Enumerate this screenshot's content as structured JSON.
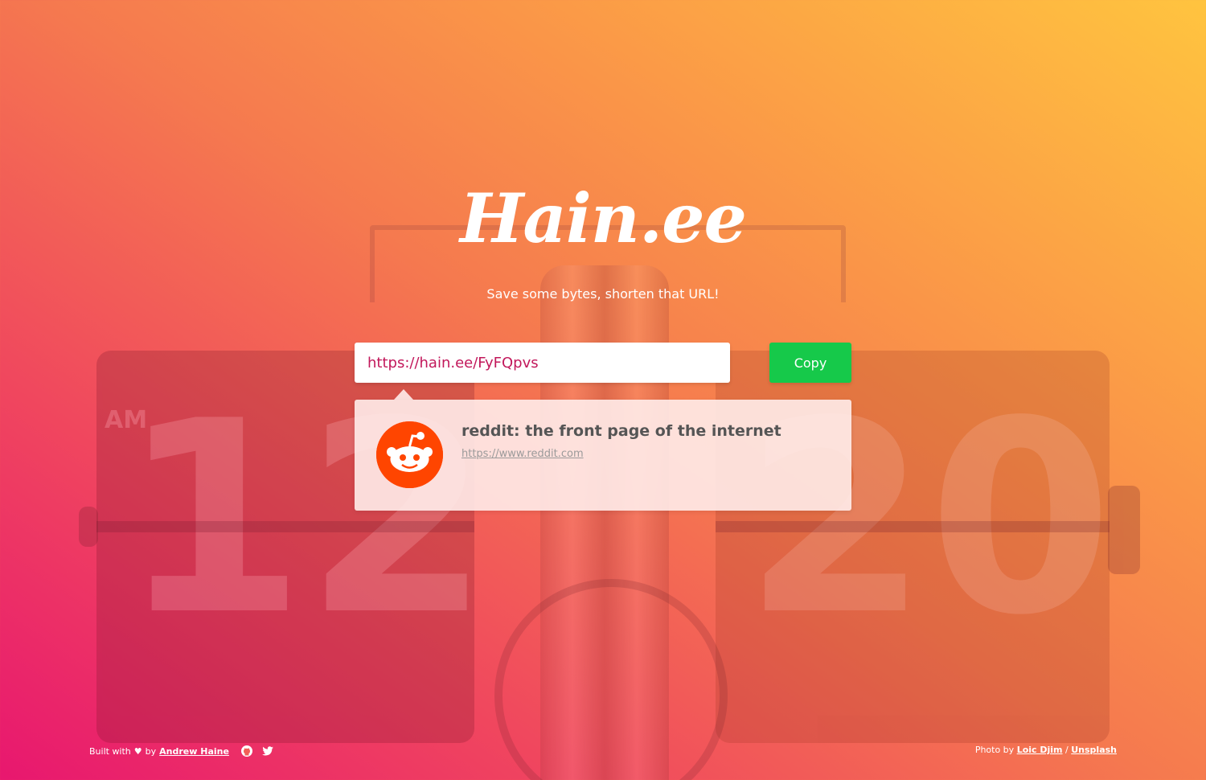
{
  "brand": {
    "logo_text": "Hain.ee",
    "tagline": "Save some bytes, shorten that URL!"
  },
  "shortener": {
    "short_url": "https://hain.ee/FyFQpvs",
    "copy_label": "Copy"
  },
  "preview": {
    "icon": "reddit-icon",
    "title": "reddit: the front page of the internet",
    "url": "https://www.reddit.com"
  },
  "footer": {
    "built_with": "Built with",
    "heart": "♥",
    "by": "by",
    "author": "Andrew Haine",
    "icons": [
      "github-icon",
      "twitter-icon"
    ],
    "photo_by": "Photo by",
    "photographer": "Loic Djim",
    "separator": "/",
    "source": "Unsplash"
  },
  "background_clock": {
    "am_label": "AM",
    "hour": "12",
    "minute": "20"
  },
  "colors": {
    "gradient_start": "#e8176f",
    "gradient_end": "#ffc43f",
    "copy_button": "#16c94a",
    "url_text": "#c2185b",
    "reddit": "#ff4500"
  }
}
